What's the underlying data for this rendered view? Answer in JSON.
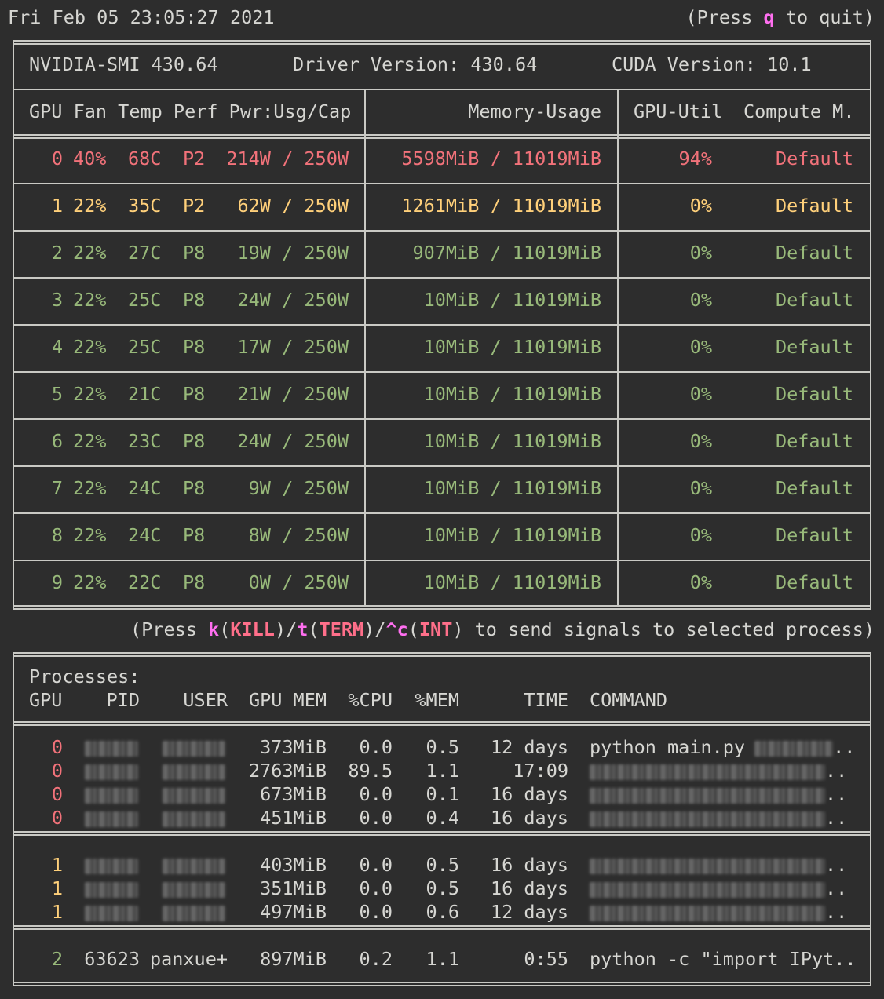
{
  "header": {
    "datetime": "Fri Feb 05 23:05:27 2021",
    "quit_prefix": "(Press ",
    "quit_key": "q",
    "quit_suffix": " to quit)"
  },
  "info": {
    "smi": "NVIDIA-SMI 430.64",
    "driver": "Driver Version: 430.64",
    "cuda": "CUDA Version: 10.1"
  },
  "gpu_table": {
    "headers": {
      "left": "GPU Fan Temp Perf Pwr:Usg/Cap",
      "memory": "Memory-Usage",
      "util": "GPU-Util",
      "compute": "Compute M."
    },
    "rows": [
      {
        "gpu": "0",
        "fan": "40%",
        "temp": "68C",
        "perf": "P2",
        "pwr": "214W / 250W",
        "mem": "5598MiB / 11019MiB",
        "util": "94%",
        "mode": "Default",
        "color": "#f2727a"
      },
      {
        "gpu": "1",
        "fan": "22%",
        "temp": "35C",
        "perf": "P2",
        "pwr": "62W / 250W",
        "mem": "1261MiB / 11019MiB",
        "util": "0%",
        "mode": "Default",
        "color": "#ffd07a"
      },
      {
        "gpu": "2",
        "fan": "22%",
        "temp": "27C",
        "perf": "P8",
        "pwr": "19W / 250W",
        "mem": "907MiB / 11019MiB",
        "util": "0%",
        "mode": "Default",
        "color": "#98b97a"
      },
      {
        "gpu": "3",
        "fan": "22%",
        "temp": "25C",
        "perf": "P8",
        "pwr": "24W / 250W",
        "mem": "10MiB / 11019MiB",
        "util": "0%",
        "mode": "Default",
        "color": "#98b97a"
      },
      {
        "gpu": "4",
        "fan": "22%",
        "temp": "25C",
        "perf": "P8",
        "pwr": "17W / 250W",
        "mem": "10MiB / 11019MiB",
        "util": "0%",
        "mode": "Default",
        "color": "#98b97a"
      },
      {
        "gpu": "5",
        "fan": "22%",
        "temp": "21C",
        "perf": "P8",
        "pwr": "21W / 250W",
        "mem": "10MiB / 11019MiB",
        "util": "0%",
        "mode": "Default",
        "color": "#98b97a"
      },
      {
        "gpu": "6",
        "fan": "22%",
        "temp": "23C",
        "perf": "P8",
        "pwr": "24W / 250W",
        "mem": "10MiB / 11019MiB",
        "util": "0%",
        "mode": "Default",
        "color": "#98b97a"
      },
      {
        "gpu": "7",
        "fan": "22%",
        "temp": "24C",
        "perf": "P8",
        "pwr": "9W / 250W",
        "mem": "10MiB / 11019MiB",
        "util": "0%",
        "mode": "Default",
        "color": "#98b97a"
      },
      {
        "gpu": "8",
        "fan": "22%",
        "temp": "24C",
        "perf": "P8",
        "pwr": "8W / 250W",
        "mem": "10MiB / 11019MiB",
        "util": "0%",
        "mode": "Default",
        "color": "#98b97a"
      },
      {
        "gpu": "9",
        "fan": "22%",
        "temp": "22C",
        "perf": "P8",
        "pwr": "0W / 250W",
        "mem": "10MiB / 11019MiB",
        "util": "0%",
        "mode": "Default",
        "color": "#98b97a"
      }
    ]
  },
  "signals": {
    "prefix": "(Press ",
    "k": "k",
    "kill": "KILL",
    "t": "t",
    "term": "TERM",
    "c": "^c",
    "int": "INT",
    "suffix": " to send signals to selected process)"
  },
  "processes": {
    "title": "Processes:",
    "headers": {
      "gpu": "GPU",
      "pid": "PID",
      "user": "USER",
      "gpu_mem": "GPU MEM",
      "cpu": "%CPU",
      "mem": "%MEM",
      "time": "TIME",
      "command": "COMMAND"
    },
    "groups": [
      [
        {
          "gpu": "0",
          "gpu_color": "#f2727a",
          "pid": "",
          "user": "",
          "gpu_mem": "373MiB",
          "cpu": "0.0",
          "mem": "0.5",
          "time": "12 days",
          "command": "python main.py",
          "cmd_tail": ".."
        },
        {
          "gpu": "0",
          "gpu_color": "#f2727a",
          "pid": "",
          "user": "",
          "gpu_mem": "2763MiB",
          "cpu": "89.5",
          "mem": "1.1",
          "time": "17:09",
          "command": "",
          "cmd_tail": ".."
        },
        {
          "gpu": "0",
          "gpu_color": "#f2727a",
          "pid": "",
          "user": "",
          "gpu_mem": "673MiB",
          "cpu": "0.0",
          "mem": "0.1",
          "time": "16 days",
          "command": "",
          "cmd_tail": ".."
        },
        {
          "gpu": "0",
          "gpu_color": "#f2727a",
          "pid": "",
          "user": "",
          "gpu_mem": "451MiB",
          "cpu": "0.0",
          "mem": "0.4",
          "time": "16 days",
          "command": "",
          "cmd_tail": ".."
        }
      ],
      [
        {
          "gpu": "1",
          "gpu_color": "#ffd07a",
          "pid": "",
          "user": "",
          "gpu_mem": "403MiB",
          "cpu": "0.0",
          "mem": "0.5",
          "time": "16 days",
          "command": "",
          "cmd_tail": ".."
        },
        {
          "gpu": "1",
          "gpu_color": "#ffd07a",
          "pid": "",
          "user": "",
          "gpu_mem": "351MiB",
          "cpu": "0.0",
          "mem": "0.5",
          "time": "16 days",
          "command": "",
          "cmd_tail": ".."
        },
        {
          "gpu": "1",
          "gpu_color": "#ffd07a",
          "pid": "",
          "user": "",
          "gpu_mem": "497MiB",
          "cpu": "0.0",
          "mem": "0.6",
          "time": "12 days",
          "command": "",
          "cmd_tail": ".."
        }
      ],
      [
        {
          "gpu": "2",
          "gpu_color": "#98b97a",
          "pid": "63623",
          "user": "panxue+",
          "gpu_mem": "897MiB",
          "cpu": "0.2",
          "mem": "1.1",
          "time": "0:55",
          "command": "python -c \"import IPyt..",
          "cmd_tail": ""
        }
      ]
    ]
  }
}
